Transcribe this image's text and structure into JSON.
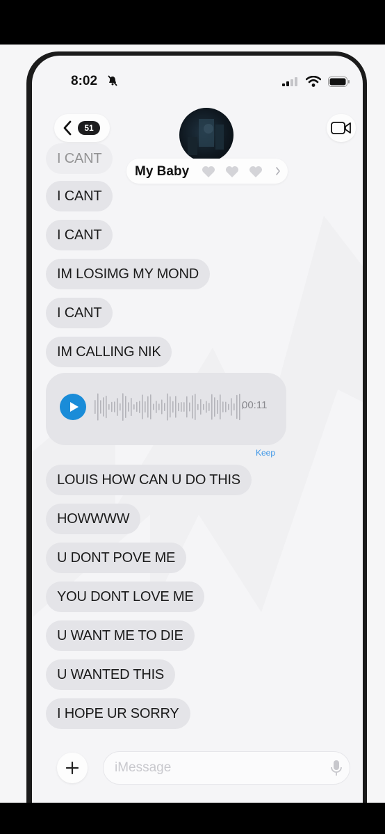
{
  "status_bar": {
    "time": "8:02"
  },
  "header": {
    "unread_count": "51",
    "contact_name": "My Baby"
  },
  "messages": [
    "I CANT",
    "I CANT",
    "I CANT",
    "IM LOSIMG MY MOND",
    "I CANT",
    "IM CALLING NIK"
  ],
  "voice_message": {
    "duration": "00:11",
    "keep_label": "Keep"
  },
  "messages_after": [
    "LOUIS HOW CAN U DO THIS",
    "HOWWWW",
    "U DONT POVE ME",
    "YOU DONT LOVE ME",
    "U WANT ME TO DIE",
    "U WANTED THIS",
    "I HOPE UR SORRY"
  ],
  "composer": {
    "placeholder": "iMessage"
  },
  "colors": {
    "bubble": "#e4e4e8",
    "accent": "#1a8cd8",
    "keep": "#3b95e6"
  }
}
